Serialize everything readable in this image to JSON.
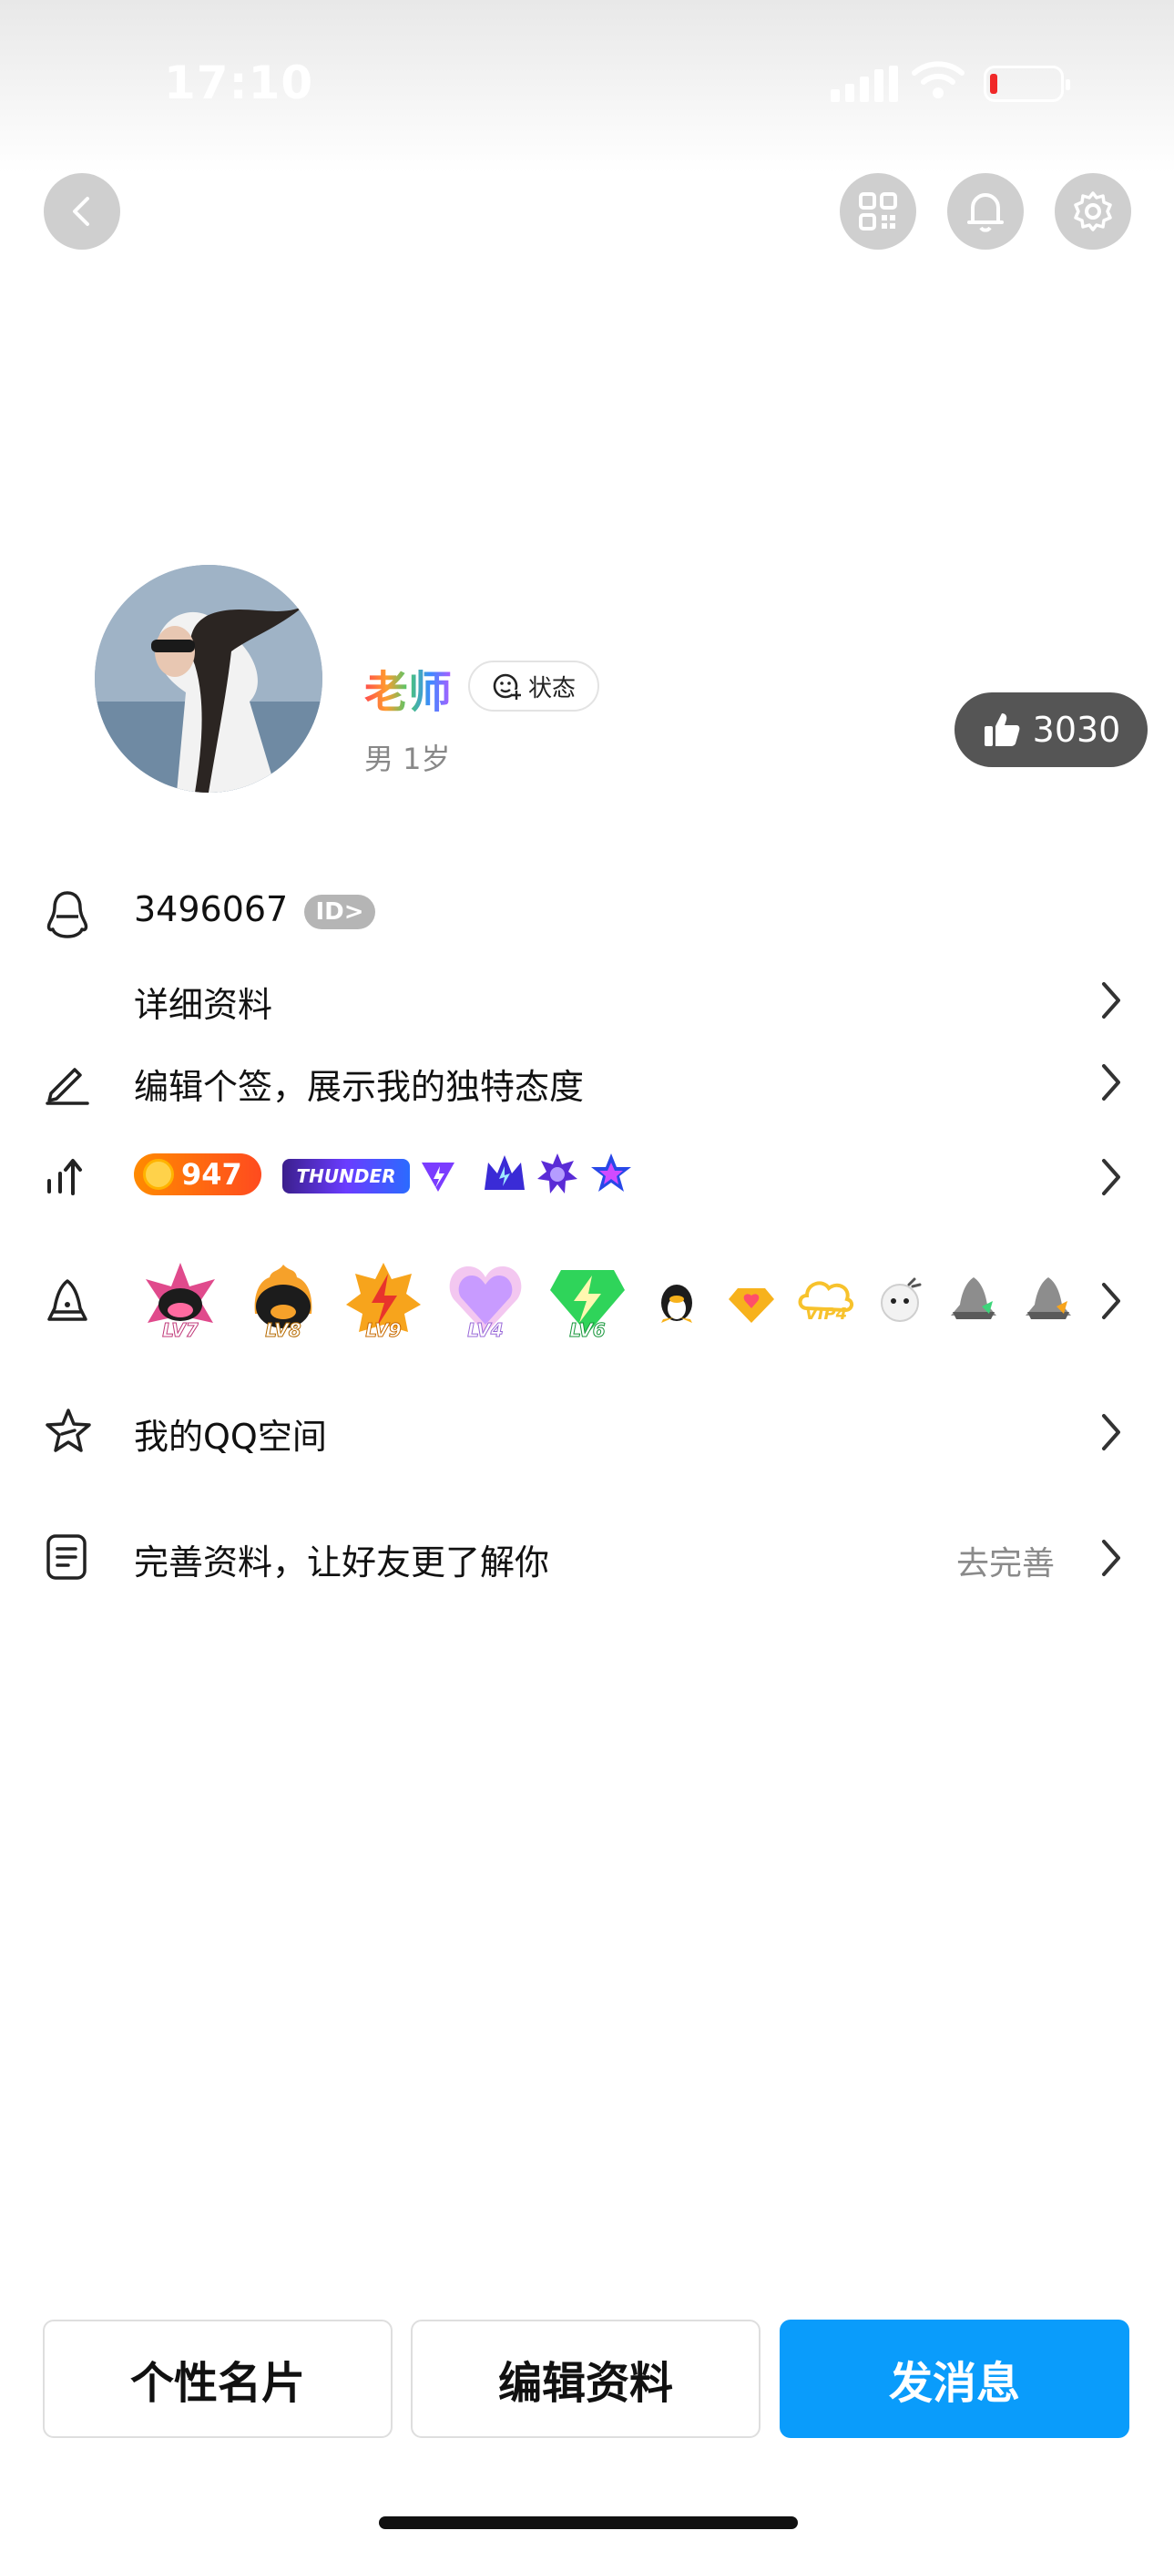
{
  "status_bar": {
    "time": "17:10"
  },
  "profile": {
    "name": "老师",
    "status_label": "状态",
    "meta": "男  1岁",
    "likes": "3030"
  },
  "rows": {
    "qq_number": "3496067",
    "id_badge": "ID>",
    "details": "详细资料",
    "signature": "编辑个签，展示我的独特态度",
    "gold_value": "947",
    "thunder_label": "THUNDER",
    "badge_levels": [
      "LV7",
      "LV8",
      "LV9",
      "LV4",
      "LV6",
      "VIP4"
    ],
    "qzone": "我的QQ空间",
    "complete_profile": "完善资料，让好友更了解你",
    "complete_action": "去完善"
  },
  "actions": {
    "card": "个性名片",
    "edit": "编辑资料",
    "message": "发消息"
  },
  "colors": {
    "accent": "#0a9cfb",
    "likes_bg": "#555555"
  }
}
